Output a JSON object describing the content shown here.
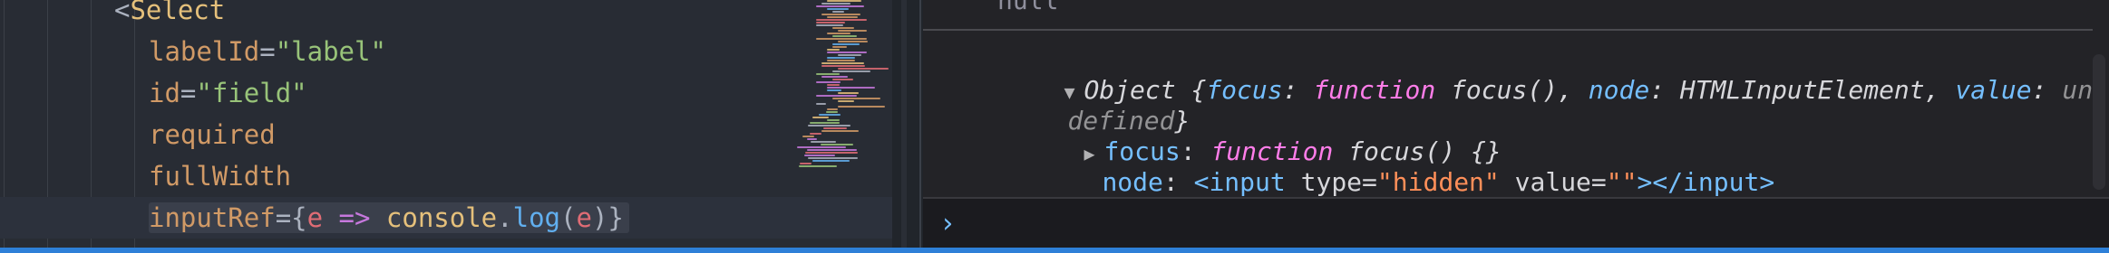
{
  "editor": {
    "lines": [
      {
        "name": "code-line-select-open",
        "tokens": [
          {
            "t": "<",
            "c": "punct"
          },
          {
            "t": "Select",
            "c": "tag"
          }
        ]
      },
      {
        "name": "code-line-labelid",
        "tokens": [
          {
            "t": "labelId",
            "c": "attr"
          },
          {
            "t": "=",
            "c": "punct"
          },
          {
            "t": "\"label\"",
            "c": "str"
          }
        ]
      },
      {
        "name": "code-line-id",
        "tokens": [
          {
            "t": "id",
            "c": "attr"
          },
          {
            "t": "=",
            "c": "punct"
          },
          {
            "t": "\"field\"",
            "c": "str"
          }
        ]
      },
      {
        "name": "code-line-required",
        "tokens": [
          {
            "t": "required",
            "c": "attr"
          }
        ]
      },
      {
        "name": "code-line-fullwidth",
        "tokens": [
          {
            "t": "fullWidth",
            "c": "attr"
          }
        ]
      },
      {
        "name": "code-line-inputref",
        "current": true,
        "tokens": [
          {
            "t": "inputRef",
            "c": "attr"
          },
          {
            "t": "={",
            "c": "punct"
          },
          {
            "t": "e",
            "c": "var"
          },
          {
            "t": " => ",
            "c": "op"
          },
          {
            "t": "console",
            "c": "obj"
          },
          {
            "t": ".",
            "c": "punct"
          },
          {
            "t": "log",
            "c": "fn"
          },
          {
            "t": "(",
            "c": "punct"
          },
          {
            "t": "e",
            "c": "var"
          },
          {
            "t": ")}",
            "c": "punct"
          }
        ]
      }
    ]
  },
  "console": {
    "prev_value": "null",
    "object_summary": {
      "twisty": "▼",
      "type": "Object",
      "open_brace": " {",
      "focus_key": "focus",
      "colon": ": ",
      "function_kw": "function",
      "focus_sig": " focus()",
      "comma": ", ",
      "node_key": "node",
      "node_type": "HTMLInputElement",
      "value_key": "value",
      "value_part1": "un",
      "value_part2": "defined",
      "close_brace": "}"
    },
    "focus_row": {
      "twisty": "▶",
      "key": "focus",
      "colon": ": ",
      "kw": "function",
      "sig": " focus() {}"
    },
    "node_row": {
      "key": "node",
      "colon": ": ",
      "open": "<input",
      "attr1": " type",
      "eq1": "=",
      "val1": "\"hidden\"",
      "attr2": " value",
      "eq2": "=",
      "val2": "\"\"",
      "close": "></input>"
    },
    "value_row": {
      "key": "value",
      "colon": ": ",
      "val": "undefined"
    },
    "prompt": "›"
  },
  "colors": {
    "editor_bg": "#282c34",
    "console_bg": "#232327",
    "accent_blue": "#2e80d8"
  }
}
